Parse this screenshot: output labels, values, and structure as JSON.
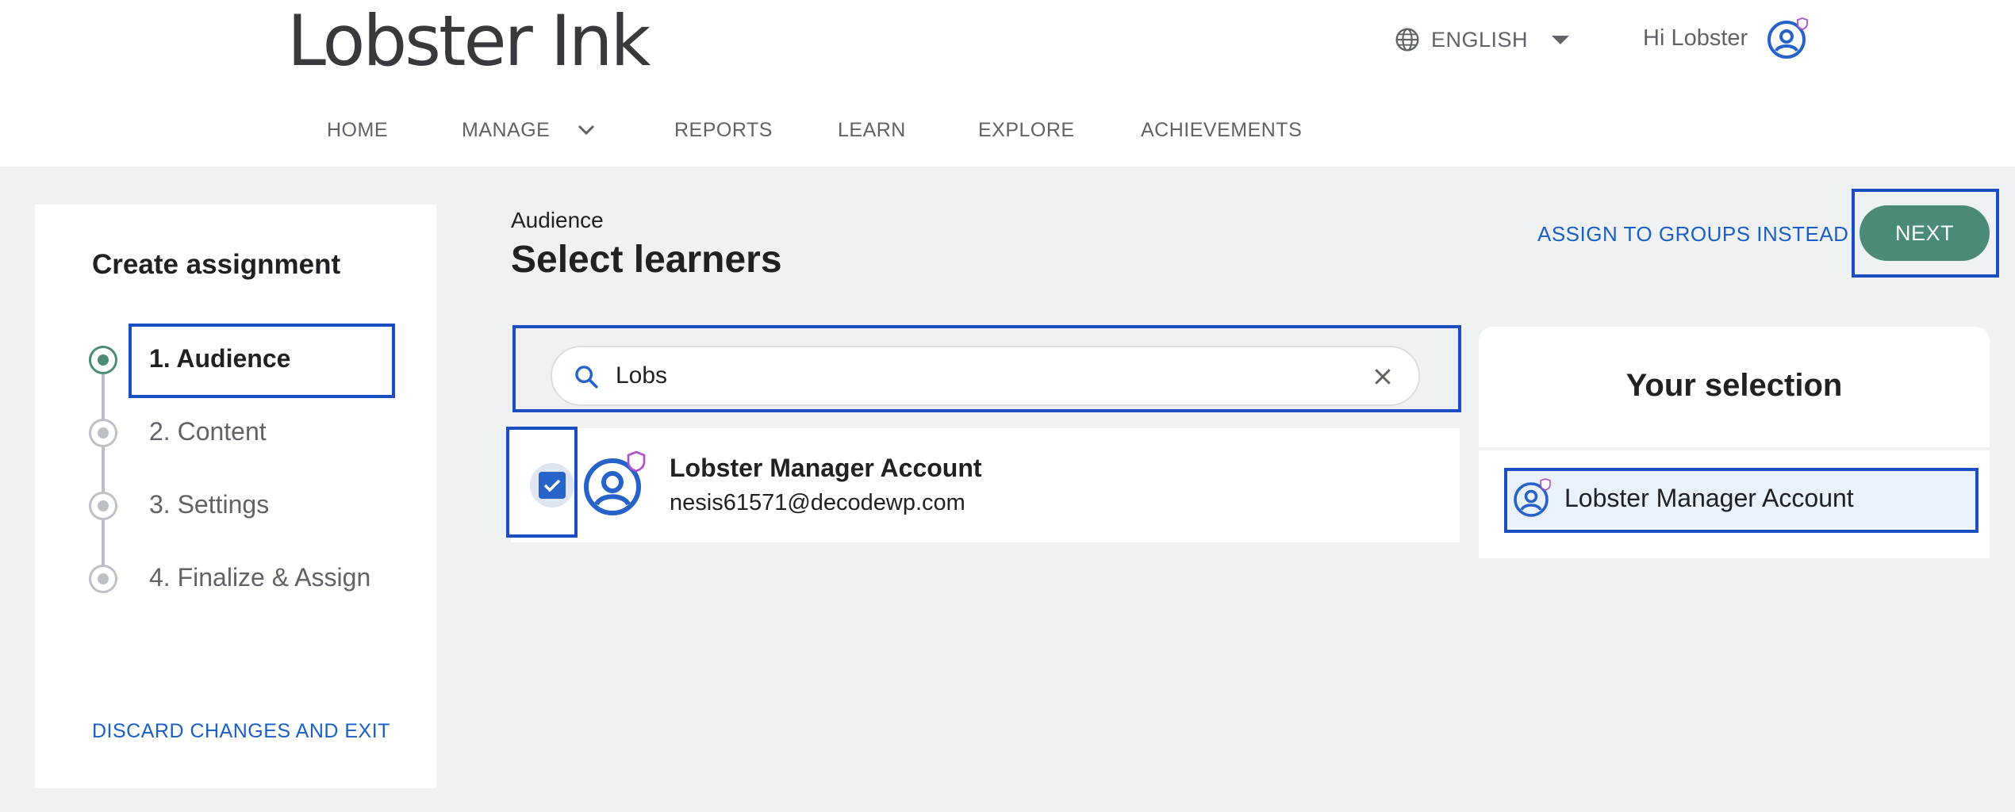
{
  "header": {
    "logo": "Lobster Ink",
    "language": "ENGLISH",
    "greeting": "Hi Lobster"
  },
  "nav": {
    "items": [
      "HOME",
      "MANAGE",
      "REPORTS",
      "LEARN",
      "EXPLORE",
      "ACHIEVEMENTS"
    ]
  },
  "sidebar": {
    "title": "Create assignment",
    "steps": [
      "1. Audience",
      "2. Content",
      "3. Settings",
      "4. Finalize & Assign"
    ],
    "active_step": 0,
    "discard_label": "DISCARD CHANGES AND EXIT"
  },
  "main": {
    "breadcrumb": "Audience",
    "title": "Select learners",
    "assign_groups_label": "ASSIGN TO GROUPS INSTEAD",
    "next_label": "NEXT",
    "search": {
      "value": "Lobs"
    },
    "results": [
      {
        "name": "Lobster Manager Account",
        "email": "nesis61571@decodewp.com",
        "checked": true
      }
    ]
  },
  "selection": {
    "title": "Your selection",
    "items": [
      "Lobster Manager Account"
    ]
  },
  "colors": {
    "accent_green": "#4a8a77",
    "link_blue": "#1a5fc6",
    "checkbox_blue": "#2762c9",
    "admin_badge": "#b04fd0"
  }
}
